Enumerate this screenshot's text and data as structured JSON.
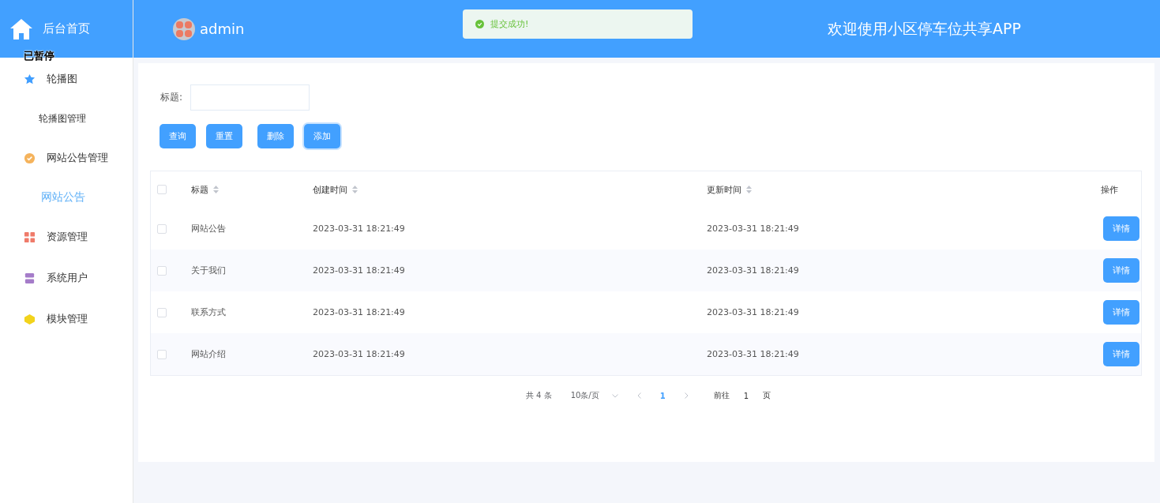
{
  "sidebar": {
    "home": "后台首页",
    "overlay_text": "已暂停",
    "menu": [
      {
        "label": "轮播图",
        "color": "#409eff",
        "children": [
          {
            "label": "轮播图管理",
            "selected": false
          }
        ]
      },
      {
        "label": "网站公告管理",
        "color": "#f5b35c",
        "children": [
          {
            "label": "网站公告",
            "selected": true
          }
        ]
      },
      {
        "label": "资源管理",
        "color": "#ef7b6a"
      },
      {
        "label": "系统用户",
        "color": "#a57cc9"
      },
      {
        "label": "模块管理",
        "color": "#f2d31c"
      }
    ]
  },
  "header": {
    "user": "admin",
    "toast": {
      "kind": "success",
      "text": "提交成功!"
    },
    "title": "欢迎使用小区停车位共享APP"
  },
  "search": {
    "label": "标题:"
  },
  "buttons": [
    {
      "label": "查询",
      "focused": false
    },
    {
      "label": "重置",
      "focused": false
    },
    {
      "label": "删除",
      "focused": false
    },
    {
      "label": "添加",
      "focused": true
    }
  ],
  "table": {
    "all_checked": false,
    "columns": [
      "标题",
      "创建时间",
      "更新时间",
      "操作"
    ],
    "rows": [
      {
        "checked": false,
        "title": "网站公告",
        "created": "2023-03-31 18:21:49",
        "updated": "2023-03-31 18:21:49",
        "action": "详情"
      },
      {
        "checked": false,
        "title": "关于我们",
        "created": "2023-03-31 18:21:49",
        "updated": "2023-03-31 18:21:49",
        "action": "详情"
      },
      {
        "checked": false,
        "title": "联系方式",
        "created": "2023-03-31 18:21:49",
        "updated": "2023-03-31 18:21:49",
        "action": "详情"
      },
      {
        "checked": false,
        "title": "网站介绍",
        "created": "2023-03-31 18:21:49",
        "updated": "2023-03-31 18:21:49",
        "action": "详情"
      }
    ]
  },
  "pagination": {
    "total": "共 4 条",
    "page_size": "10条/页",
    "pages": [
      {
        "label": "1",
        "selected": true
      }
    ],
    "goto_label": "前往",
    "goto_value": "1",
    "goto_suffix": "页"
  }
}
